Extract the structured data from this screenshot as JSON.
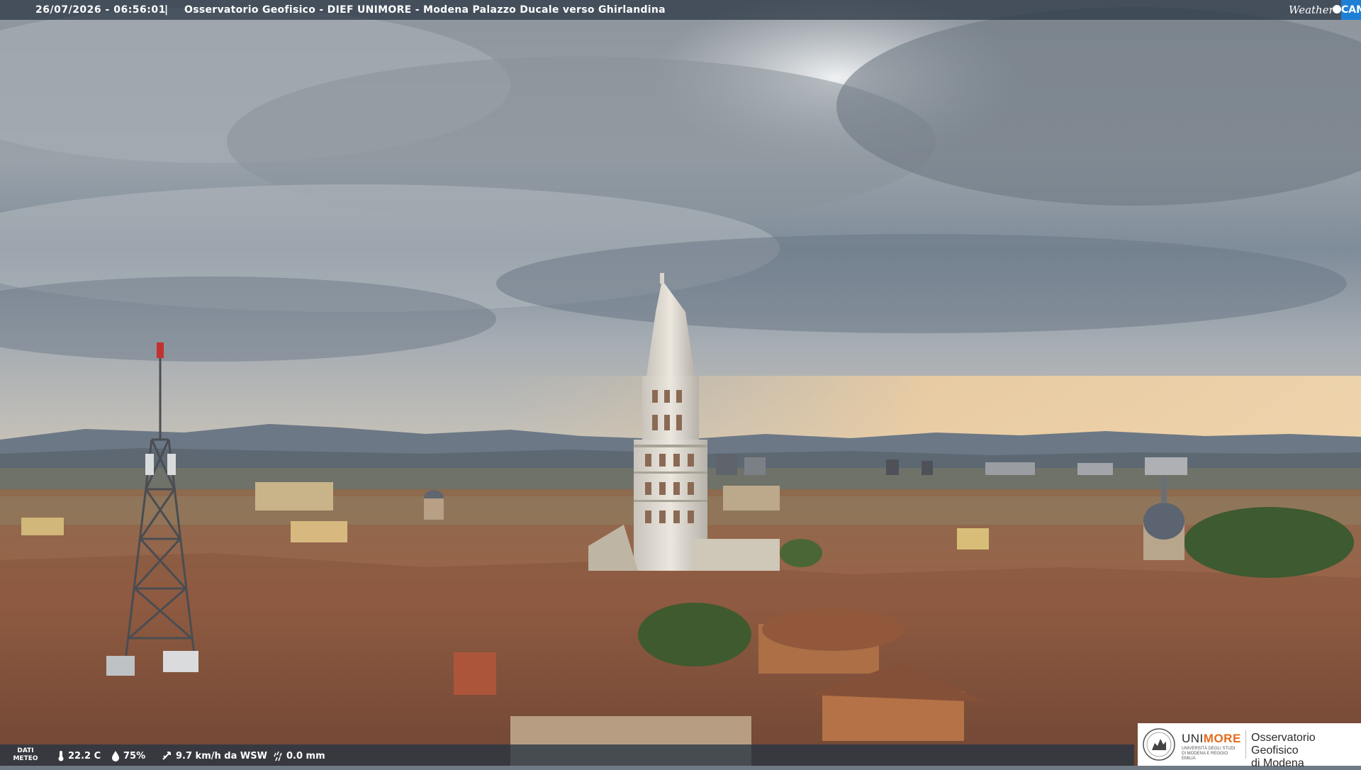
{
  "header": {
    "timestamp": "26/07/2026 - 06:56:01",
    "separator": "|",
    "title": "Osservatorio Geofisico - DIEF UNIMORE - Modena Palazzo Ducale verso Ghirlandina"
  },
  "brand": {
    "weather_text": "Weather",
    "cam_text": "CAM",
    "accent": "#1e7fd6"
  },
  "meteo": {
    "label_line1": "DATI",
    "label_line2": "METEO",
    "temperature": "22.2 C",
    "humidity": "75%",
    "wind": "9.7 km/h da WSW",
    "rain": "0.0 mm",
    "icons": [
      "thermometer-icon",
      "humidity-icon",
      "wind-icon",
      "rain-icon"
    ]
  },
  "logo": {
    "uni_prefix": "UNI",
    "uni_suffix": "MORE",
    "uni_subtitle": "UNIVERSITÀ DEGLI STUDI DI MODENA E REGGIO EMILIA",
    "observatory_line1": "Osservatorio Geofisico",
    "observatory_line2": "di Modena",
    "accent": "#e36b1f"
  }
}
